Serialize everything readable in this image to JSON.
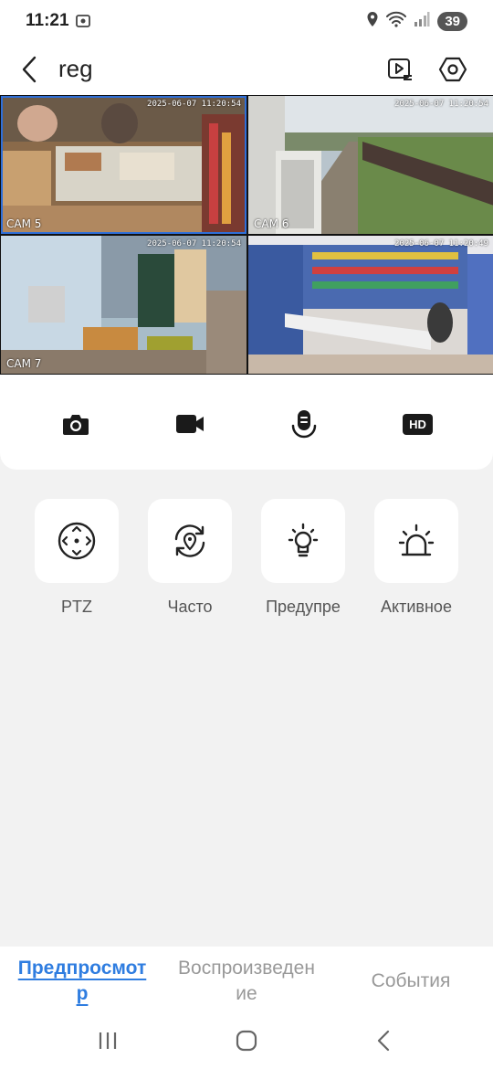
{
  "status_bar": {
    "time": "11:21",
    "battery": "39"
  },
  "header": {
    "title": "reg"
  },
  "video_grid": {
    "tiles": [
      {
        "label": "CAM 5",
        "stamp": "2025-06-07 11:20:54"
      },
      {
        "label": "CAM 6",
        "stamp": "2025-06-07 11:20:54"
      },
      {
        "label": "CAM 7",
        "stamp": "2025-06-07 11:20:54"
      },
      {
        "label": "",
        "stamp": "2025-06-07 11:20:49"
      }
    ]
  },
  "controls": {
    "hd_label": "HD"
  },
  "functions": [
    {
      "label": "PTZ",
      "icon": "ptz-icon"
    },
    {
      "label": "Часто",
      "icon": "location-refresh-icon"
    },
    {
      "label": "Предупре",
      "icon": "light-bulb-icon"
    },
    {
      "label": "Активное",
      "icon": "siren-icon"
    }
  ],
  "tabs": [
    {
      "label": "Предпросмотр",
      "active": true
    },
    {
      "label": "Воспроизведение",
      "active": false
    },
    {
      "label": "События",
      "active": false
    }
  ],
  "colors": {
    "accent": "#2f7de0",
    "selection": "#2f6fd8",
    "background": "#f2f2f2"
  }
}
